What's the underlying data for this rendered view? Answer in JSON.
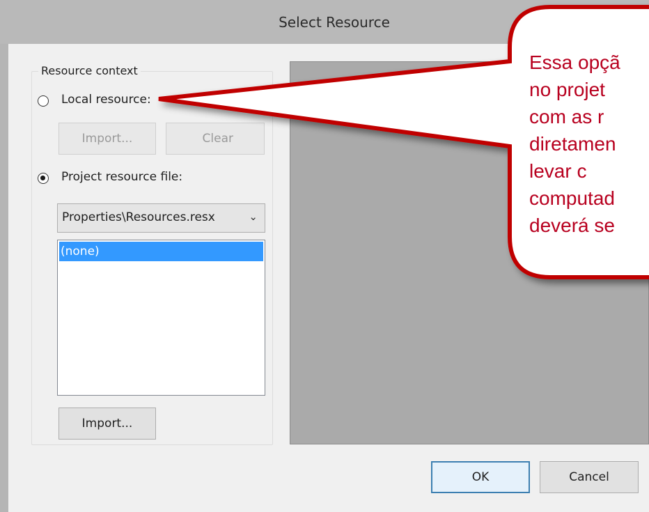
{
  "window": {
    "title": "Select Resource"
  },
  "resource_context": {
    "group_label": "Resource context",
    "local_resource_label": "Local resource:",
    "local_resource_selected": false,
    "import_disabled_label": "Import...",
    "clear_label": "Clear",
    "project_resource_label": "Project resource file:",
    "project_resource_selected": true,
    "resource_file_value": "Properties\\Resources.resx",
    "resource_list": [
      "(none)"
    ],
    "import_label": "Import..."
  },
  "footer": {
    "ok_label": "OK",
    "cancel_label": "Cancel"
  },
  "callout": {
    "lines": [
      "Essa opçã",
      "no projet",
      "com as r",
      "diretamen",
      "levar c",
      "computad",
      "deverá se"
    ],
    "border_color": "#c00000",
    "text_color": "#b8001f"
  },
  "icons": {
    "dropdown": "chevron-down-icon"
  }
}
